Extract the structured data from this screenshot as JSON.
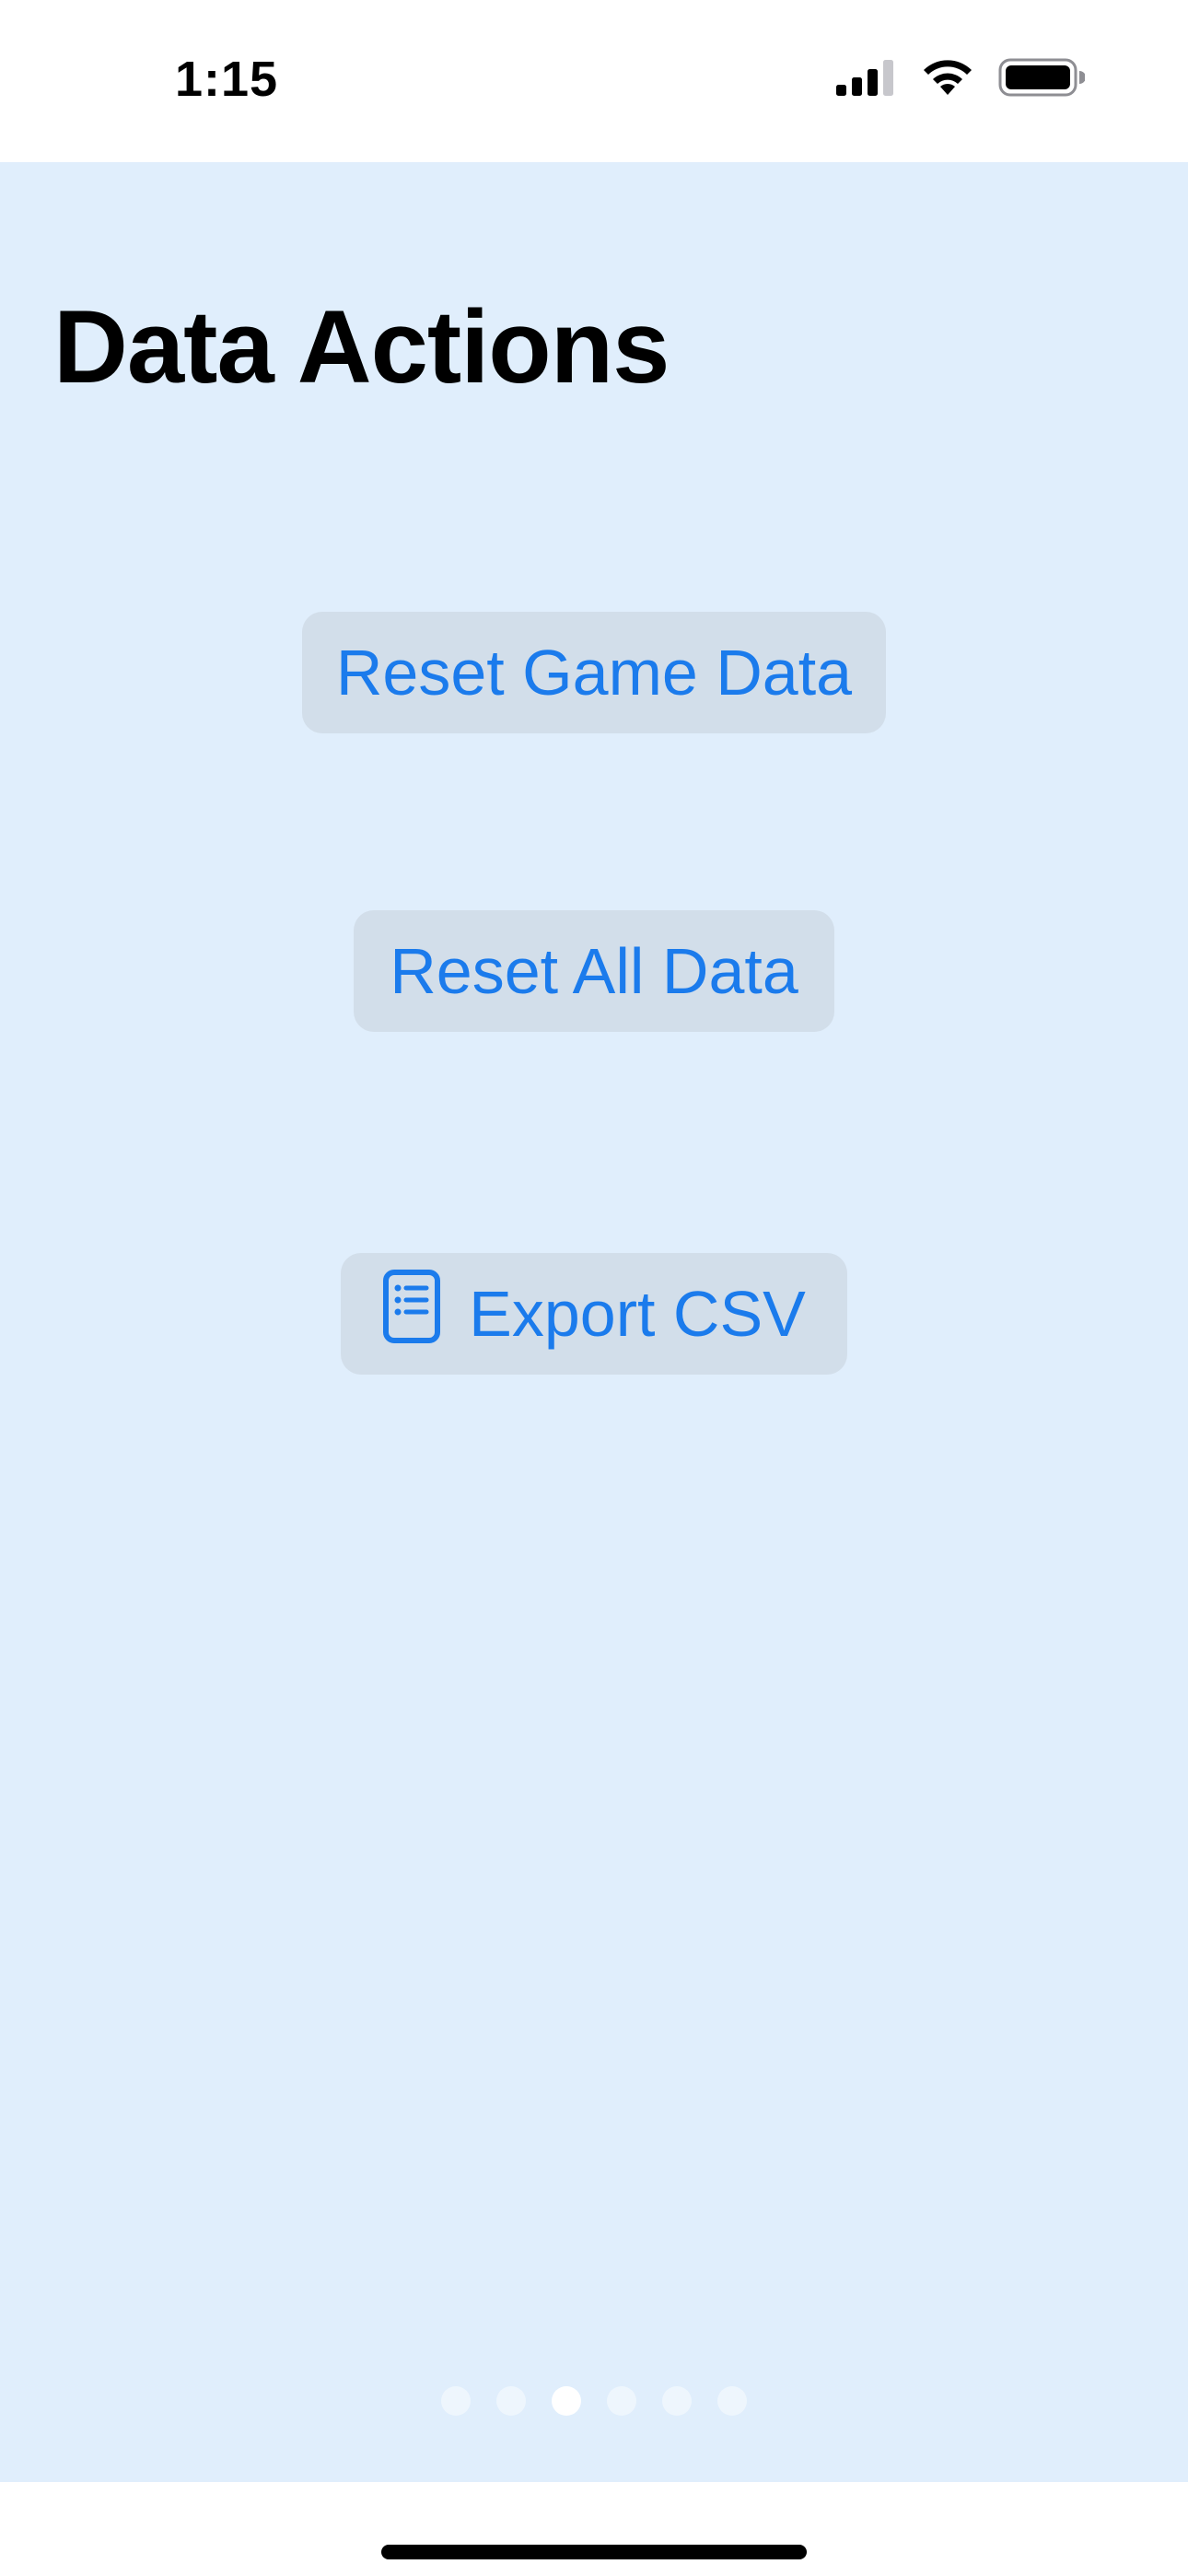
{
  "status_bar": {
    "time": "1:15",
    "icons": [
      "cellular-signal-icon",
      "wifi-icon",
      "battery-icon"
    ]
  },
  "page": {
    "title": "Data Actions"
  },
  "actions": {
    "reset_game_label": "Reset Game Data",
    "reset_all_label": "Reset All Data",
    "export_csv_label": "Export CSV",
    "export_icon": "document-list-icon"
  },
  "pager": {
    "page_count": 6,
    "current_page": 3
  },
  "colors": {
    "background": "#e0eefc",
    "button_background": "#d2deea",
    "accent": "#1b7bec"
  }
}
